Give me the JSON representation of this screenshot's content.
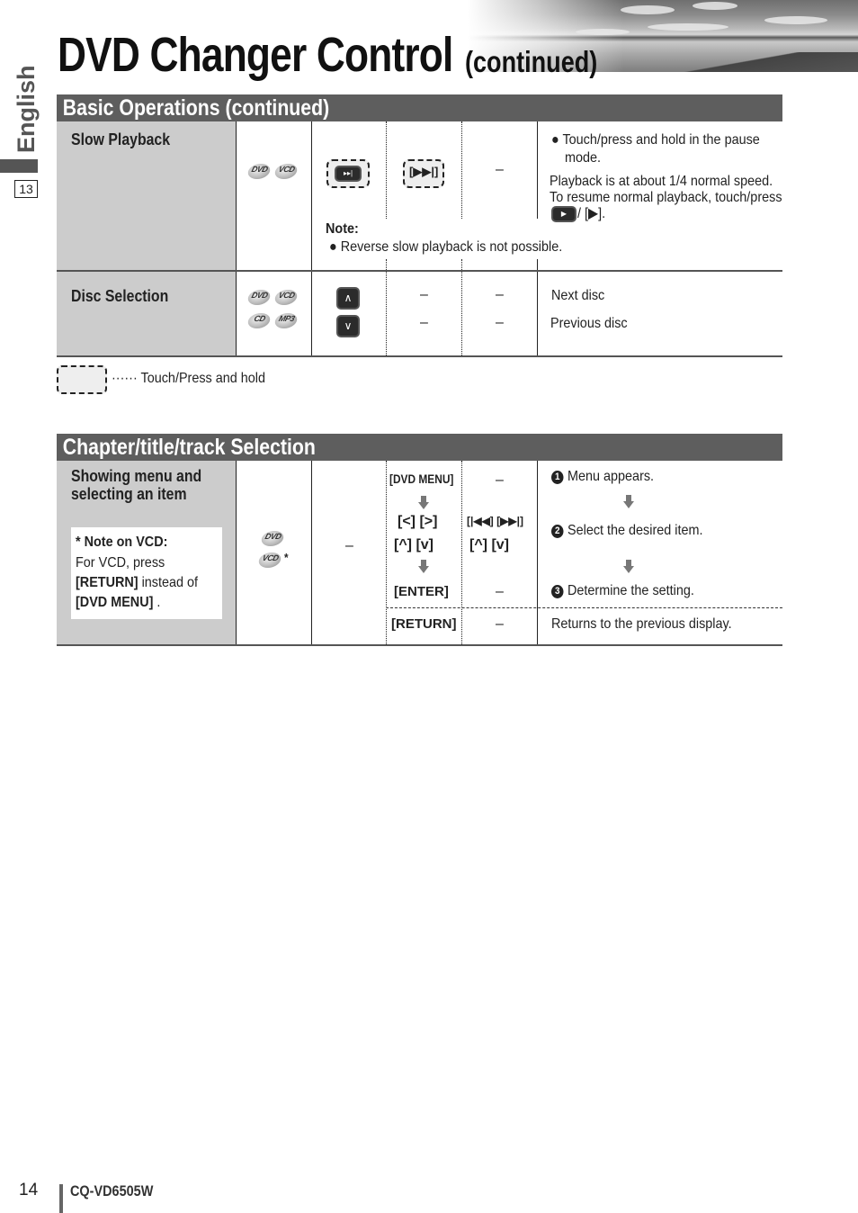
{
  "page": {
    "title": "DVD Changer Control",
    "title_suffix": "(continued)",
    "side_language": "English",
    "side_page_box": "13",
    "page_number": "14",
    "model": "CQ-VD6505W"
  },
  "basic_operations": {
    "header": "Basic Operations  (continued)",
    "rows": [
      {
        "label": "Slow Playback",
        "discs": [
          "DVD",
          "VCD"
        ],
        "touch_key_icon": "slow-forward-button",
        "remote_key": "[▶▶|]",
        "col3": "–",
        "bullet": "Touch/press and hold in the pause",
        "bullet_cont": "mode.",
        "desc_line1": "Playback is at about 1/4 normal speed.",
        "desc_line2": "To resume normal playback, touch/press",
        "desc_line3_suffix": "/ [▶].",
        "note_title": "Note:",
        "note_text": "Reverse slow playback is not possible."
      },
      {
        "label": "Disc Selection",
        "discs": [
          "DVD",
          "VCD",
          "CD",
          "MP3"
        ],
        "buttons": [
          "^",
          "v"
        ],
        "col3": [
          "–",
          "–"
        ],
        "col4": [
          "–",
          "–"
        ],
        "desc": [
          "Next disc",
          "Previous disc"
        ]
      }
    ],
    "legend": "······ Touch/Press and hold"
  },
  "chapter_selection": {
    "header": "Chapter/title/track Selection",
    "label_line1": "Showing menu and",
    "label_line2": "selecting an item",
    "note_title": "* Note on VCD:",
    "note_line1": "For VCD, press",
    "note_key1": "[RETURN]",
    "note_line2_suffix": " instead of",
    "note_key2": "[DVD MENU]",
    "note_line3_suffix": " .",
    "discs": [
      "DVD",
      "VCD"
    ],
    "vcd_asterisk": "*",
    "touch_col": "–",
    "remote_keys": {
      "dvd_menu": "[DVD MENU]",
      "left_right": "[<] [>]",
      "up_down": "[^] [v]",
      "enter": "[ENTER]",
      "return": "[RETURN]"
    },
    "alt_keys": {
      "dash1": "–",
      "skip": "[|◀◀] [▶▶|]",
      "up_down": "[^] [v]",
      "dash2": "–",
      "dash3": "–"
    },
    "steps": [
      {
        "num": "1",
        "text": "Menu appears."
      },
      {
        "num": "2",
        "text": "Select the desired item."
      },
      {
        "num": "3",
        "text": "Determine the setting."
      }
    ],
    "return_desc": "Returns to the previous display."
  }
}
